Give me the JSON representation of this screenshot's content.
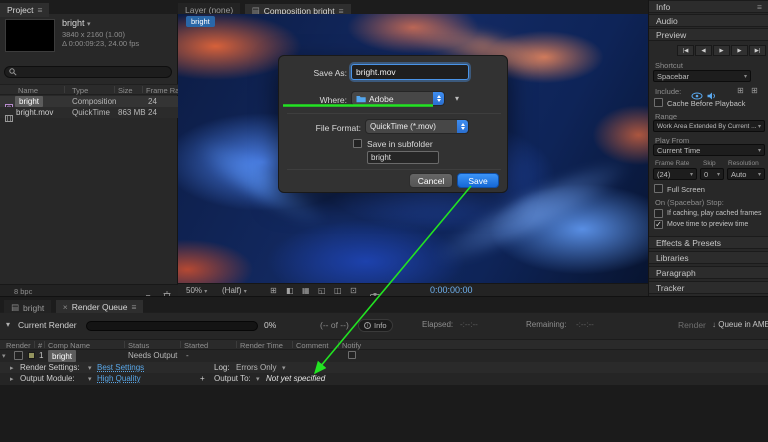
{
  "colors": {
    "accent_blue": "#59a7e8",
    "save_blue": "#1877d2",
    "annotation_green": "#22e322",
    "timecode_blue": "#6fb3f2"
  },
  "icons": {
    "menu": "≡",
    "panel_lines": "▤",
    "chevron_down": "▾",
    "twirl_open": "▾",
    "twirl_closed": "▸",
    "close": "×",
    "first_frame": "|◀",
    "prev_frame": "◀",
    "play": "▶",
    "next_frame": "▶",
    "last_frame": "▶|",
    "grid": "⊞",
    "title_safe": "⊞",
    "mask_vis": "◧",
    "channels": "▦",
    "region": "◱",
    "pixel_aspect": "◫",
    "transparency": "⊡",
    "plus": "+",
    "down_arrow": "↓",
    "info_letter": "i",
    "check": "✓"
  },
  "project": {
    "title": "Project",
    "comp_name": "bright",
    "detail_line1": "3840 x 2160 (1.00)",
    "detail_line2": "Δ 0:00:09:23, 24.00 fps",
    "columns": {
      "name": "Name",
      "type": "Type",
      "size": "Size",
      "frame_rate": "Frame Ra..."
    },
    "rows": [
      {
        "name": "bright",
        "type": "Composition",
        "size": "",
        "frame_rate": "24"
      },
      {
        "name": "bright.mov",
        "type": "QuickTime",
        "size": "863 MB",
        "frame_rate": "24"
      }
    ],
    "bit_depth": "8 bpc"
  },
  "viewer": {
    "tab_layer": "Layer (none)",
    "tab_composition": "Composition bright",
    "comp_chip": "bright",
    "zoom": "50%",
    "resolution": "(Half)",
    "timecode": "0:00:00:00"
  },
  "dialog": {
    "save_as_label": "Save As:",
    "save_as_value": "bright.mov",
    "where_label": "Where:",
    "where_value": "Adobe",
    "file_format_label": "File Format:",
    "file_format_value": "QuickTime (*.mov)",
    "subfolder_label": "Save in subfolder",
    "subfolder_value": "bright",
    "cancel_label": "Cancel",
    "save_label": "Save"
  },
  "right_panel": {
    "info": "Info",
    "audio": "Audio",
    "preview": "Preview",
    "shortcut_label": "Shortcut",
    "shortcut_value": "Spacebar",
    "include_label": "Include:",
    "cache_label": "Cache Before Playback",
    "range_label": "Range",
    "range_value": "Work Area Extended By Current ...",
    "play_from_label": "Play From",
    "play_from_value": "Current Time",
    "frame_rate_label": "Frame Rate",
    "skip_label": "Skip",
    "resolution_label": "Resolution",
    "frame_rate_value": "(24)",
    "skip_value": "0",
    "resolution_value": "Auto",
    "full_screen_label": "Full Screen",
    "stop_heading": "On (Spacebar) Stop:",
    "caching_label": "If caching, play cached frames",
    "move_time_label": "Move time to preview time",
    "effects": "Effects & Presets",
    "libraries": "Libraries",
    "paragraph": "Paragraph",
    "tracker": "Tracker"
  },
  "render_queue": {
    "tab_bright": "bright",
    "tab_queue": "Render Queue",
    "current_render": "Current Render",
    "percent": "0%",
    "of_counter": "(-- of --)",
    "info_label": "Info",
    "elapsed_label": "Elapsed:",
    "elapsed_value": "-:--:--",
    "remaining_label": "Remaining:",
    "remaining_value": "-:--:--",
    "render_button": "Render",
    "ame_button": "Queue in AME",
    "columns": {
      "render": "Render",
      "num": "#",
      "comp_name": "Comp Name",
      "status": "Status",
      "started": "Started",
      "render_time": "Render Time",
      "comment": "Comment",
      "notify": "Notify"
    },
    "item": {
      "num": "1",
      "name": "bright",
      "status": "Needs Output",
      "started": "-"
    },
    "render_settings_label": "Render Settings:",
    "render_settings_value": "Best Settings",
    "log_label": "Log:",
    "log_value": "Errors Only",
    "output_module_label": "Output Module:",
    "output_module_value": "High Quality",
    "output_to_label": "Output To:",
    "output_to_value": "Not yet specified"
  }
}
